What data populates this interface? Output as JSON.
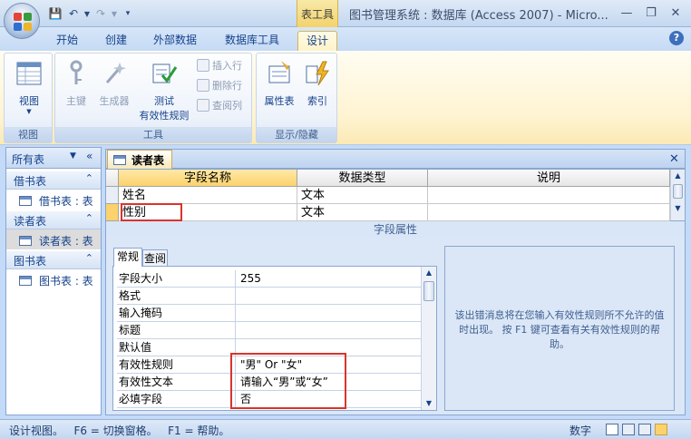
{
  "title_bar": {
    "app_title": "图书管理系统 : 数据库 (Access 2007) - Micro...",
    "contextual_tab_group": "表工具"
  },
  "tabs": [
    "开始",
    "创建",
    "外部数据",
    "数据库工具",
    "设计"
  ],
  "active_tab": "设计",
  "ribbon": {
    "groups": [
      {
        "label": "视图",
        "buttons": [
          "视图"
        ]
      },
      {
        "label": "工具",
        "buttons": [
          "主键",
          "生成器",
          "测试",
          "有效性规则",
          "插入行",
          "删除行",
          "查阅列"
        ]
      },
      {
        "label": "显示/隐藏",
        "buttons": [
          "属性表",
          "索引"
        ]
      }
    ]
  },
  "nav_pane": {
    "header": "所有表",
    "groups": [
      {
        "name": "借书表",
        "items": [
          "借书表 : 表"
        ]
      },
      {
        "name": "读者表",
        "items": [
          "读者表 : 表"
        ]
      },
      {
        "name": "图书表",
        "items": [
          "图书表 : 表"
        ]
      }
    ],
    "selected_item": "读者表 : 表"
  },
  "document": {
    "tab_label": "读者表",
    "columns": [
      "字段名称",
      "数据类型",
      "说明"
    ],
    "rows": [
      {
        "field": "姓名",
        "type": "文本",
        "desc": ""
      },
      {
        "field": "性别",
        "type": "文本",
        "desc": ""
      }
    ],
    "field_properties_title": "字段属性",
    "property_tabs": [
      "常规",
      "查阅"
    ],
    "properties": [
      {
        "name": "字段大小",
        "value": "255"
      },
      {
        "name": "格式",
        "value": ""
      },
      {
        "name": "输入掩码",
        "value": ""
      },
      {
        "name": "标题",
        "value": ""
      },
      {
        "name": "默认值",
        "value": ""
      },
      {
        "name": "有效性规则",
        "value": "\"男\" Or \"女\""
      },
      {
        "name": "有效性文本",
        "value": "请输入“男”或“女”"
      },
      {
        "name": "必填字段",
        "value": "否"
      }
    ],
    "help_text": "该出错消息将在您输入有效性规则所不允许的值时出现。 按 F1 键可查看有关有效性规则的帮助。"
  },
  "status_bar": {
    "left": "设计视图。   F6 = 切换窗格。   F1 = 帮助。",
    "mode": "数字"
  },
  "colors": {
    "accent": "#15428b",
    "highlight_box": "#d9342b",
    "contextual": "#f3d36b"
  }
}
